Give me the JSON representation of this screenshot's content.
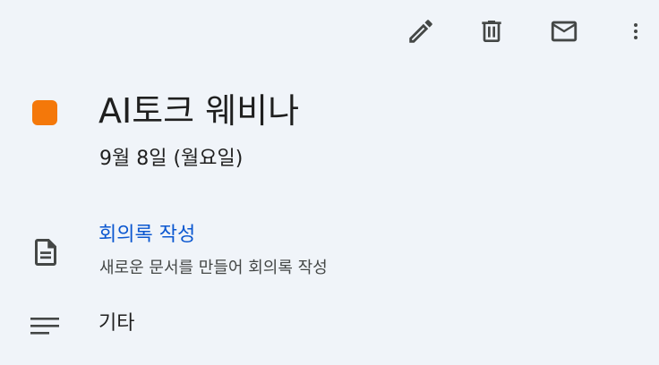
{
  "toolbar": {
    "edit_icon": "pencil-icon",
    "delete_icon": "trash-icon",
    "mail_icon": "mail-icon",
    "more_icon": "more-vert-icon"
  },
  "event": {
    "color": "#f4780a",
    "title": "AI토크 웨비나",
    "date": "9월 8일 (월요일)"
  },
  "meeting_notes": {
    "icon": "document-icon",
    "link_label": "회의록 작성",
    "description": "새로운 문서를 만들어 회의록 작성"
  },
  "other": {
    "icon": "notes-lines-icon",
    "label": "기타"
  },
  "colors": {
    "background": "#f0f4f9",
    "icon": "#444746",
    "link": "#0b57d0",
    "text": "#1f1f1f"
  }
}
